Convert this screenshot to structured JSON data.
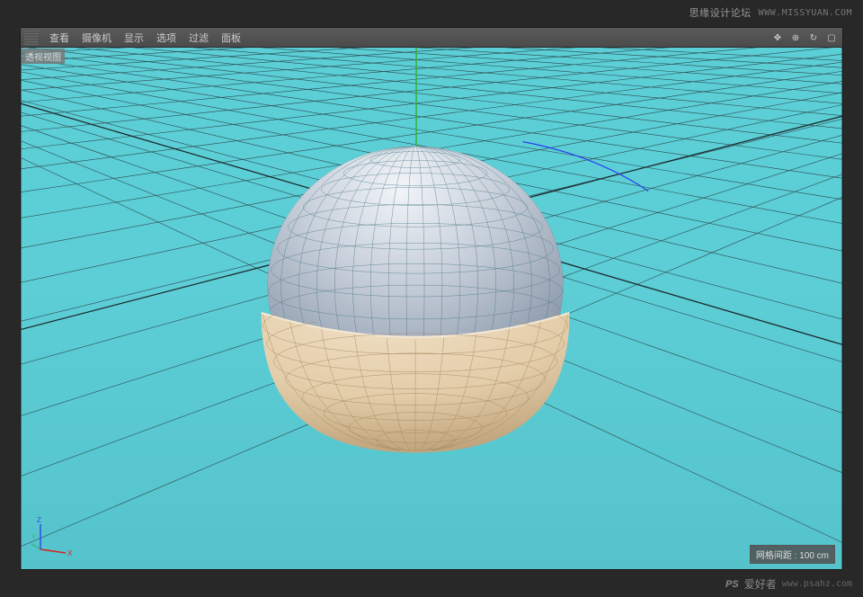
{
  "watermarks": {
    "top_label": "思缘设计论坛",
    "top_url": "WWW.MISSYUAN.COM",
    "bottom_logo": "PS",
    "bottom_cn": "爱好者",
    "bottom_url": "www.psahz.com"
  },
  "toolbar": {
    "menus": [
      "查看",
      "摄像机",
      "显示",
      "选项",
      "过滤",
      "面板"
    ]
  },
  "view": {
    "tag": "透视视图"
  },
  "status": {
    "grid_label": "网格间距 : 100 cm"
  },
  "scene": {
    "grid_spacing_cm": 100,
    "background_color": "#5dced6",
    "objects": [
      {
        "name": "sphere",
        "wireframe_color": "#2a6b78",
        "shade_top": "#e0e4ea",
        "shade_bottom": "#8a97a8"
      },
      {
        "name": "bowl",
        "wireframe_color": "#b0926e",
        "shade_outer": "#e8d3b5",
        "shade_inner_dark": "#0a1830"
      }
    ]
  },
  "axes": {
    "x": {
      "label": "X",
      "color": "#d92020"
    },
    "y": {
      "label": "Y",
      "color": "#20a020"
    },
    "z": {
      "label": "Z",
      "color": "#3050e0"
    }
  }
}
